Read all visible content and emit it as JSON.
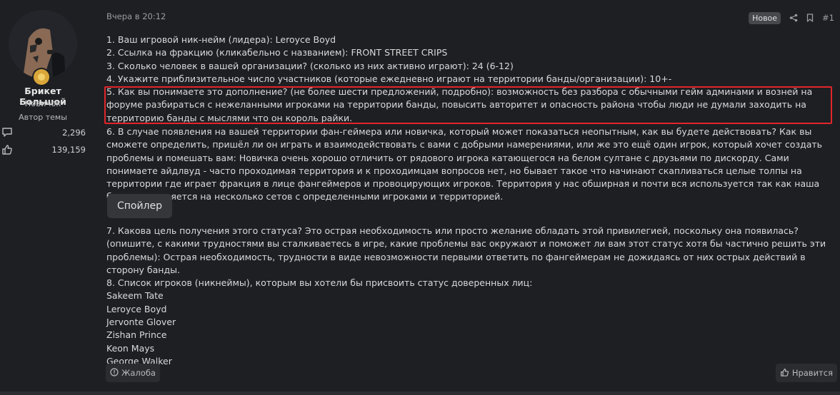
{
  "user": {
    "name": "Брикет Большой",
    "title": "Новичок",
    "author_badge": "Автор темы",
    "messages_count": "2,296",
    "likes_count": "139,159"
  },
  "post": {
    "date": "Вчера в 20:12",
    "new_badge": "Новое",
    "number": "#1",
    "lines": [
      "1. Ваш игровой ник-нейм (лидера): Leroyce Boyd",
      "2. Ссылка на фракцию (кликабельно с названием): FRONT STREET CRIPS",
      "3. Сколько человек в вашей организации? (сколько из них активно играют): 24 (6-12)",
      "4. Укажите приблизительное число участников (которые ежедневно играют на территории банды/организации): 10+-"
    ],
    "answer5": "5. Как вы понимаете это дополнение? (не более шести предложений, подробно): возможность без разбора с обычными гейм админами и возней на форуме разбираться с нежеланными игроками на территории банды, повысить авторитет и опасность района чтобы люди не думали заходить на территорию банды с мыслями что он король райки.",
    "answer6": "6. В случае появления на вашей территории фан-геймера или новичка, который может показаться неопытным, как вы будете действовать? Как вы сможете определить, пришёл ли он играть и взаимодействовать с вами с добрыми намерениями, или же это ещё один игрок, который хочет создать проблемы и помешать вам: Новичка очень хорошо отличить от рядового игрока катающегося на белом султане с друзьями по дискорду. Сами понимаете айдлвуд - часто проходимая территория и к проходимцам вопросов нет, но бывает такое что начинают скапливаться целые толпы на территории где играет фракция в лице фангеймеров и провоцирующих игроков. Территория у нас обширная и почти вся используется так как наша банда разделяется на несколько сетов с определенными игроками и территорией.",
    "spoiler_label": "Спойлер",
    "answer7": "7. Какова цель получения этого статуса? Это острая необходимость или просто желание обладать этой привилегией, поскольку она появилась? (опишите, с какими трудностями вы сталкиваетесь в игре, какие проблемы вас окружают и поможет ли вам этот статус хотя бы частично решить эти проблемы): Острая необходимость, трудности в виде невозможности первыми ответить по фангеймерам не дожидаясь от них острых действий в сторону банды.",
    "answer8_title": "8. Список игроков (никнеймы), которым вы хотели бы присвоить статус доверенных лиц:",
    "players": [
      "Sakeem Tate",
      "Leroyce Boyd",
      "Jervonte Glover",
      "Zishan Prince",
      "Keon Mays",
      "George Walker"
    ],
    "report_label": "Жалоба",
    "like_label": "Нравится"
  },
  "colors": {
    "background": "#1e1f22",
    "highlight_border": "#e2252b",
    "badge_gold": "#d9a63a"
  },
  "icons": [
    "speech-bubble-icon",
    "thumbs-up-icon",
    "share-icon",
    "bookmark-icon",
    "report-icon",
    "like-icon"
  ]
}
